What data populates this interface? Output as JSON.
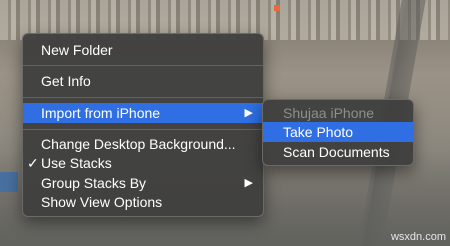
{
  "context_menu": {
    "items": [
      {
        "label": "New Folder"
      },
      {
        "label": "Get Info"
      },
      {
        "label": "Import from iPhone",
        "submenu_icon": "chevron-right-icon"
      },
      {
        "label": "Change Desktop Background..."
      },
      {
        "label": "Use Stacks",
        "check": "✓"
      },
      {
        "label": "Group Stacks By",
        "submenu_icon": "chevron-right-icon"
      },
      {
        "label": "Show View Options"
      }
    ]
  },
  "submenu": {
    "device": "Shujaa iPhone",
    "items": [
      {
        "label": "Take Photo"
      },
      {
        "label": "Scan Documents"
      }
    ]
  },
  "arrow_glyph": "▶",
  "watermark": "wsxdn.com",
  "colors": {
    "selection": "#2f6fe3",
    "menu_bg": "#403f3e"
  }
}
